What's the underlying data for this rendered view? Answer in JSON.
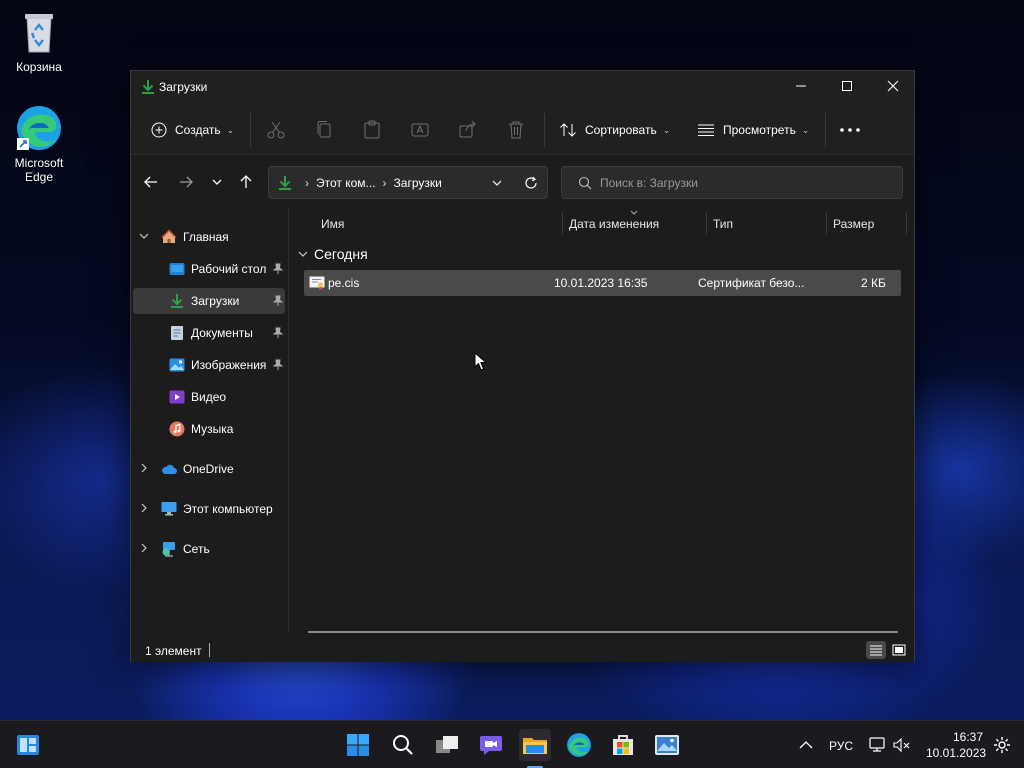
{
  "desktop": {
    "icons": [
      {
        "label": "Корзина"
      },
      {
        "label": "Microsoft Edge"
      }
    ]
  },
  "window": {
    "title": "Загрузки",
    "toolbar": {
      "create_label": "Создать",
      "sort_label": "Сортировать",
      "view_label": "Просмотреть"
    },
    "address": {
      "segment1": "Этот ком...",
      "segment2": "Загрузки"
    },
    "search": {
      "placeholder": "Поиск в: Загрузки"
    },
    "sidebar": {
      "home": "Главная",
      "items": [
        {
          "label": "Рабочий стол"
        },
        {
          "label": "Загрузки"
        },
        {
          "label": "Документы"
        },
        {
          "label": "Изображения"
        },
        {
          "label": "Видео"
        },
        {
          "label": "Музыка"
        }
      ],
      "onedrive": "OneDrive",
      "this_pc": "Этот компьютер",
      "network": "Сеть"
    },
    "columns": {
      "name": "Имя",
      "date": "Дата изменения",
      "type": "Тип",
      "size": "Размер"
    },
    "group": "Сегодня",
    "files": [
      {
        "name": "pe.cis",
        "date": "10.01.2023 16:35",
        "type": "Сертификат безо...",
        "size": "2 КБ"
      }
    ],
    "status": "1 элемент"
  },
  "taskbar": {
    "language": "РУС",
    "time": "16:37",
    "date": "10.01.2023"
  },
  "colors": {
    "accent": "#2ea043",
    "folder": "#f2c14e",
    "edge": "#1fa2e5"
  }
}
